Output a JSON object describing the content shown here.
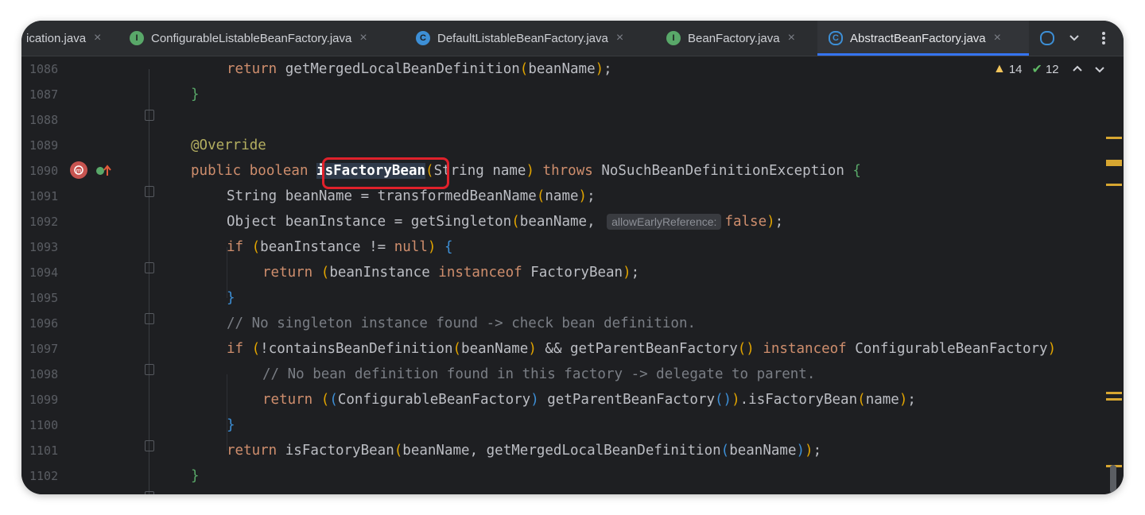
{
  "tabs": [
    {
      "label": "ication.java",
      "icon": "none",
      "active": false
    },
    {
      "label": "ConfigurableListableBeanFactory.java",
      "icon": "I",
      "active": false
    },
    {
      "label": "DefaultListableBeanFactory.java",
      "icon": "C",
      "active": false
    },
    {
      "label": "BeanFactory.java",
      "icon": "I",
      "active": false
    },
    {
      "label": "AbstractBeanFactory.java",
      "icon": "C",
      "active": true
    }
  ],
  "tab_close_glyph": "×",
  "inspections": {
    "warnings": "14",
    "weak_warnings": "12"
  },
  "hint": "allowEarlyReference:",
  "lines": [
    {
      "num": "1086"
    },
    {
      "num": "1087"
    },
    {
      "num": "1088"
    },
    {
      "num": "1089"
    },
    {
      "num": "1090"
    },
    {
      "num": "1091"
    },
    {
      "num": "1092"
    },
    {
      "num": "1093"
    },
    {
      "num": "1094"
    },
    {
      "num": "1095"
    },
    {
      "num": "1096"
    },
    {
      "num": "1097"
    },
    {
      "num": "1098"
    },
    {
      "num": "1099"
    },
    {
      "num": "1100"
    },
    {
      "num": "1101"
    },
    {
      "num": "1102"
    }
  ],
  "code": {
    "l1086": "return getMergedLocalBeanDefinition(beanName);",
    "l1089": "@Override",
    "l1090_method": "isFactoryBean",
    "l1096": "// No singleton instance found -> check bean definition.",
    "l1098": "// No bean definition found in this factory -> delegate to parent."
  },
  "colors": {
    "accent": "#3574f0",
    "highlight_box": "#e0212b",
    "warning": "#f2c55c"
  }
}
